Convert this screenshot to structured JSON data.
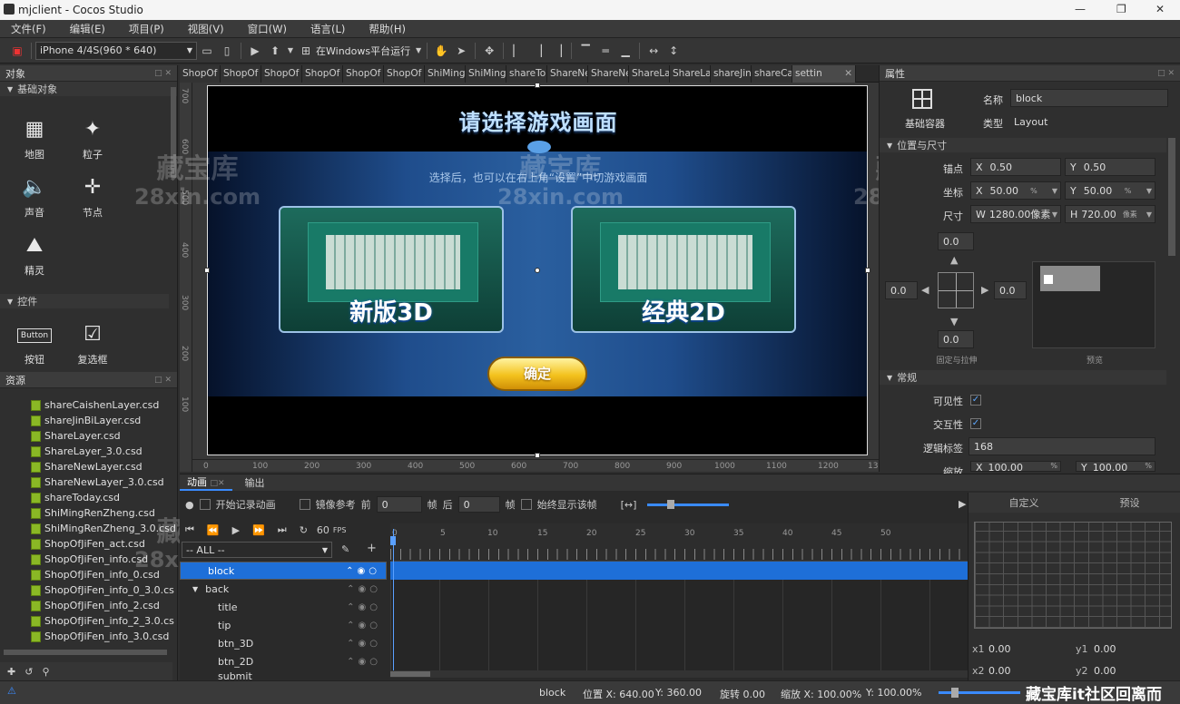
{
  "window": {
    "title": "mjclient - Cocos Studio"
  },
  "menu": [
    "文件(F)",
    "编辑(E)",
    "项目(P)",
    "视图(V)",
    "窗口(W)",
    "语言(L)",
    "帮助(H)"
  ],
  "toolbar": {
    "device": "iPhone 4/4S(960 * 640)",
    "run_target": "在Windows平台运行"
  },
  "objects_panel": {
    "title": "对象",
    "section_basic": "基础对象",
    "basic_items": [
      "地图",
      "粒子",
      "声音",
      "节点",
      "精灵"
    ],
    "section_controls": "控件",
    "control_items": [
      "按钮",
      "复选框"
    ],
    "button_icon_text": "Button"
  },
  "resources_panel": {
    "title": "资源",
    "files": [
      "shareCaishenLayer.csd",
      "shareJinBiLayer.csd",
      "ShareLayer.csd",
      "ShareLayer_3.0.csd",
      "ShareNewLayer.csd",
      "ShareNewLayer_3.0.csd",
      "shareToday.csd",
      "ShiMingRenZheng.csd",
      "ShiMingRenZheng_3.0.csd",
      "ShopOfJiFen_act.csd",
      "ShopOfJiFen_info.csd",
      "ShopOfJiFen_info_0.csd",
      "ShopOfJiFen_info_0_3.0.cs",
      "ShopOfJiFen_info_2.csd",
      "ShopOfJiFen_info_2_3.0.cs",
      "ShopOfJiFen_info_3.0.csd"
    ]
  },
  "canvas": {
    "tabs": [
      "ShopOf",
      "ShopOf",
      "ShopOf",
      "ShopOf",
      "ShopOf",
      "ShopOf",
      "ShiMing",
      "ShiMing",
      "shareTo",
      "ShareNe",
      "ShareNe",
      "ShareLa",
      "ShareLa",
      "shareJin",
      "shareCa",
      "settin"
    ],
    "ruler_left": [
      "700",
      "600",
      "500",
      "400",
      "300",
      "200",
      "100"
    ],
    "ruler_bottom": [
      "0",
      "100",
      "200",
      "300",
      "400",
      "500",
      "600",
      "700",
      "800",
      "900",
      "1000",
      "1100",
      "1200",
      "13"
    ],
    "scene": {
      "title": "请选择游戏画面",
      "tip": "选择后，也可以在右上角“设置”中切游戏画面",
      "mode_3d": "新版3D",
      "mode_2d": "经典2D",
      "confirm": "确定"
    },
    "watermark_cn": "藏宝库",
    "watermark_en": "28xin.com"
  },
  "properties": {
    "title": "属性",
    "container_label": "基础容器",
    "name_label": "名称",
    "name_value": "block",
    "type_label": "类型",
    "type_value": "Layout",
    "section_pos": "位置与尺寸",
    "anchor_label": "锚点",
    "anchor_x": "0.50",
    "anchor_y": "0.50",
    "pos_label": "坐标",
    "pos_x": "50.00",
    "pos_y": "50.00",
    "pos_unit": "%",
    "size_label": "尺寸",
    "size_w": "1280.00像素",
    "size_h": "720.00",
    "size_h_unit": "像素",
    "axis_x": "X",
    "axis_y": "Y",
    "axis_w": "W",
    "axis_h": "H",
    "margin_top": "0.0",
    "margin_left": "0.0",
    "margin_right": "0.0",
    "margin_bottom": "0.0",
    "stretch_label": "固定与拉伸",
    "preview_label": "预览",
    "section_general": "常规",
    "visible_label": "可见性",
    "interactive_label": "交互性",
    "tag_label": "逻辑标签",
    "tag_value": "168",
    "scale_label": "缩放",
    "scale_x": "100.00",
    "scale_y": "100.00",
    "scale_unit": "%"
  },
  "animation": {
    "tab_anim": "动画",
    "tab_output": "输出",
    "record": "开始记录动画",
    "onion": "镜像参考",
    "prev": "前",
    "prev_val": "0",
    "next": "后",
    "next_val": "0",
    "frame_unit": "帧",
    "always_show": "始终显示该帧",
    "fps_value": "60",
    "fps_label": "FPS",
    "filter": "-- ALL --",
    "ruler": [
      "0",
      "5",
      "10",
      "15",
      "20",
      "25",
      "30",
      "35",
      "40",
      "45",
      "50"
    ],
    "tree": [
      {
        "label": "block",
        "level": 0,
        "selected": true
      },
      {
        "label": "back",
        "level": 0,
        "selected": false
      },
      {
        "label": "title",
        "level": 1,
        "selected": false
      },
      {
        "label": "tip",
        "level": 1,
        "selected": false
      },
      {
        "label": "btn_3D",
        "level": 1,
        "selected": false
      },
      {
        "label": "btn_2D",
        "level": 1,
        "selected": false
      },
      {
        "label": "submit",
        "level": 1,
        "selected": false
      }
    ],
    "curve_tab_custom": "自定义",
    "curve_tab_preset": "预设",
    "x1_label": "x1",
    "x1_val": "0.00",
    "y1_label": "y1",
    "y1_val": "0.00",
    "x2_label": "x2",
    "x2_val": "0.00",
    "y2_label": "y2",
    "y2_val": "0.00"
  },
  "status": {
    "node": "block",
    "position": "位置 X: 640.00",
    "pos_y": "Y: 360.00",
    "rotation": "旋转 0.00",
    "scale": "缩放 X: 100.00%",
    "scale_y": "Y: 100.00%",
    "watermark": "藏宝库it社区回离而"
  }
}
